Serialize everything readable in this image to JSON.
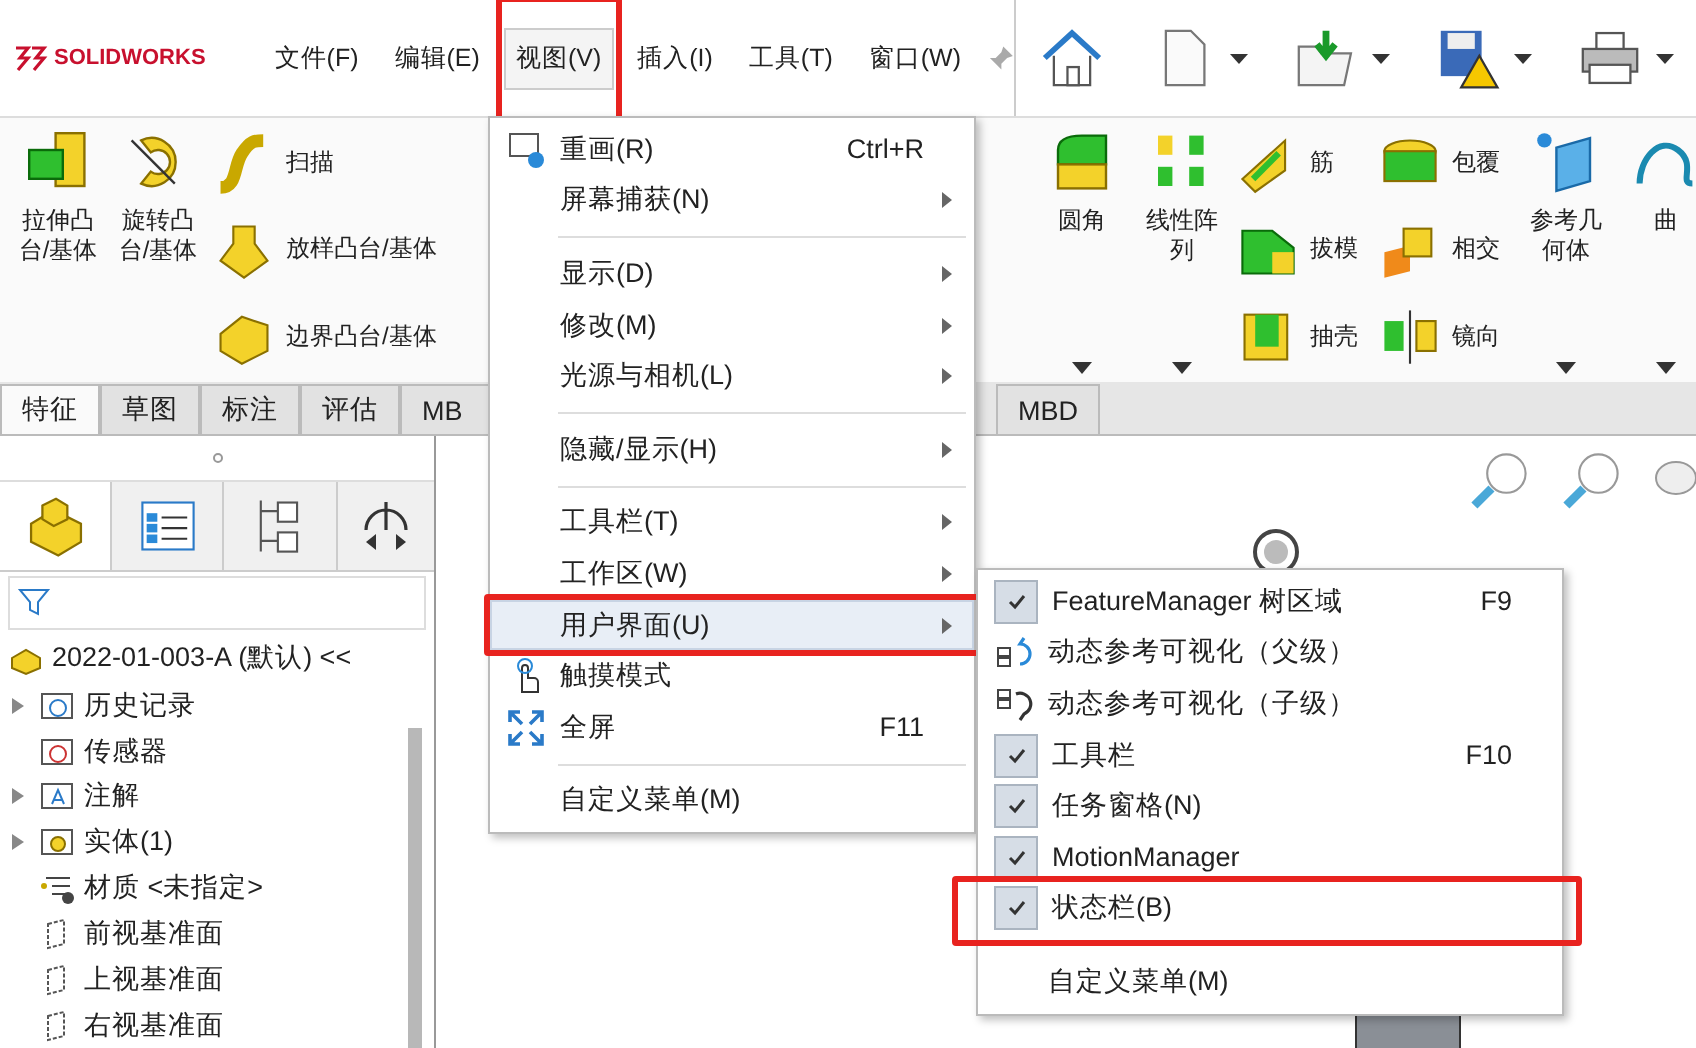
{
  "app": {
    "logo": "SOLIDWORKS"
  },
  "menu_bar": [
    {
      "label": "文件(F)",
      "selected": false,
      "annotated": false
    },
    {
      "label": "编辑(E)",
      "selected": false,
      "annotated": false
    },
    {
      "label": "视图(V)",
      "selected": true,
      "annotated": true
    },
    {
      "label": "插入(I)",
      "selected": false,
      "annotated": false
    },
    {
      "label": "工具(T)",
      "selected": false,
      "annotated": false
    },
    {
      "label": "窗口(W)",
      "selected": false,
      "annotated": false
    }
  ],
  "quick_access": [
    {
      "kind": "home"
    },
    {
      "kind": "new"
    },
    {
      "kind": "open"
    },
    {
      "kind": "save"
    },
    {
      "kind": "print"
    }
  ],
  "ribbon_left": [
    {
      "kind": "large",
      "label": "拉伸凸台/基体"
    },
    {
      "kind": "large",
      "label": "旋转凸台/基体"
    },
    {
      "kind": "stack",
      "items": [
        {
          "label": "扫描"
        },
        {
          "label": "放样凸台/基体"
        },
        {
          "label": "边界凸台/基体"
        }
      ]
    }
  ],
  "ribbon_right": [
    {
      "kind": "dropdown",
      "label": "圆角"
    },
    {
      "kind": "dropdown",
      "label": "线性阵列"
    },
    {
      "kind": "stack",
      "items": [
        {
          "label": "筋"
        },
        {
          "label": "拔模"
        },
        {
          "label": "抽壳"
        }
      ]
    },
    {
      "kind": "stack",
      "items": [
        {
          "label": "包覆"
        },
        {
          "label": "相交"
        },
        {
          "label": "镜向"
        }
      ]
    },
    {
      "kind": "dropdown",
      "label": "参考几何体"
    },
    {
      "kind": "dropdown",
      "label": "曲"
    }
  ],
  "ribbon_tabs": [
    {
      "label": "特征",
      "selected": true
    },
    {
      "label": "草图",
      "selected": false
    },
    {
      "label": "标注",
      "selected": false
    },
    {
      "label": "评估",
      "selected": false
    },
    {
      "label": "MB",
      "selected": false
    }
  ],
  "ribbon_tabs_right": [
    {
      "label": "MBD",
      "selected": false
    }
  ],
  "tree": {
    "root": "2022-01-003-A (默认) <<",
    "children": [
      {
        "label": "历史记录",
        "expandable": true
      },
      {
        "label": "传感器",
        "expandable": false
      },
      {
        "label": "注解",
        "expandable": true
      },
      {
        "label": "实体(1)",
        "expandable": true
      },
      {
        "label": "材质 <未指定>",
        "expandable": false
      },
      {
        "label": "前视基准面",
        "expandable": false
      },
      {
        "label": "上视基准面",
        "expandable": false
      },
      {
        "label": "右视基准面",
        "expandable": false
      }
    ]
  },
  "view_menu": [
    {
      "kind": "icon",
      "label": "重画(R)",
      "shortcut": "Ctrl+R",
      "submenu": false,
      "selected": false,
      "annotated": false
    },
    {
      "kind": "plain",
      "label": "屏幕捕获(N)",
      "submenu": true,
      "selected": false,
      "annotated": false
    },
    {
      "kind": "separator"
    },
    {
      "kind": "plain",
      "label": "显示(D)",
      "submenu": true,
      "selected": false,
      "annotated": false
    },
    {
      "kind": "plain",
      "label": "修改(M)",
      "submenu": true,
      "selected": false,
      "annotated": false
    },
    {
      "kind": "plain",
      "label": "光源与相机(L)",
      "submenu": true,
      "selected": false,
      "annotated": false
    },
    {
      "kind": "separator"
    },
    {
      "kind": "plain",
      "label": "隐藏/显示(H)",
      "submenu": true,
      "selected": false,
      "annotated": false
    },
    {
      "kind": "separator"
    },
    {
      "kind": "plain",
      "label": "工具栏(T)",
      "submenu": true,
      "selected": false,
      "annotated": false
    },
    {
      "kind": "plain",
      "label": "工作区(W)",
      "submenu": true,
      "selected": false,
      "annotated": false
    },
    {
      "kind": "plain",
      "label": "用户界面(U)",
      "submenu": true,
      "selected": true,
      "annotated": true
    },
    {
      "kind": "icon",
      "label": "触摸模式",
      "submenu": false,
      "selected": false,
      "annotated": false
    },
    {
      "kind": "icon",
      "label": "全屏",
      "shortcut": "F11",
      "submenu": false,
      "selected": false,
      "annotated": false
    },
    {
      "kind": "separator"
    },
    {
      "kind": "plain",
      "label": "自定义菜单(M)",
      "submenu": false,
      "selected": false,
      "annotated": false
    }
  ],
  "ui_submenu": [
    {
      "kind": "check",
      "label": "FeatureManager 树区域",
      "shortcut": "F9",
      "checked": true,
      "annotated": false
    },
    {
      "kind": "icon",
      "label": "动态参考可视化（父级）",
      "annotated": false
    },
    {
      "kind": "icon",
      "label": "动态参考可视化（子级）",
      "annotated": false
    },
    {
      "kind": "check",
      "label": "工具栏",
      "shortcut": "F10",
      "checked": true,
      "annotated": false
    },
    {
      "kind": "check",
      "label": "任务窗格(N)",
      "checked": true,
      "annotated": false
    },
    {
      "kind": "check",
      "label": "MotionManager",
      "checked": true,
      "annotated": false
    },
    {
      "kind": "check",
      "label": "状态栏(B)",
      "checked": true,
      "annotated": true
    },
    {
      "kind": "separator"
    },
    {
      "kind": "plain",
      "label": "自定义菜单(M)",
      "annotated": false
    }
  ]
}
